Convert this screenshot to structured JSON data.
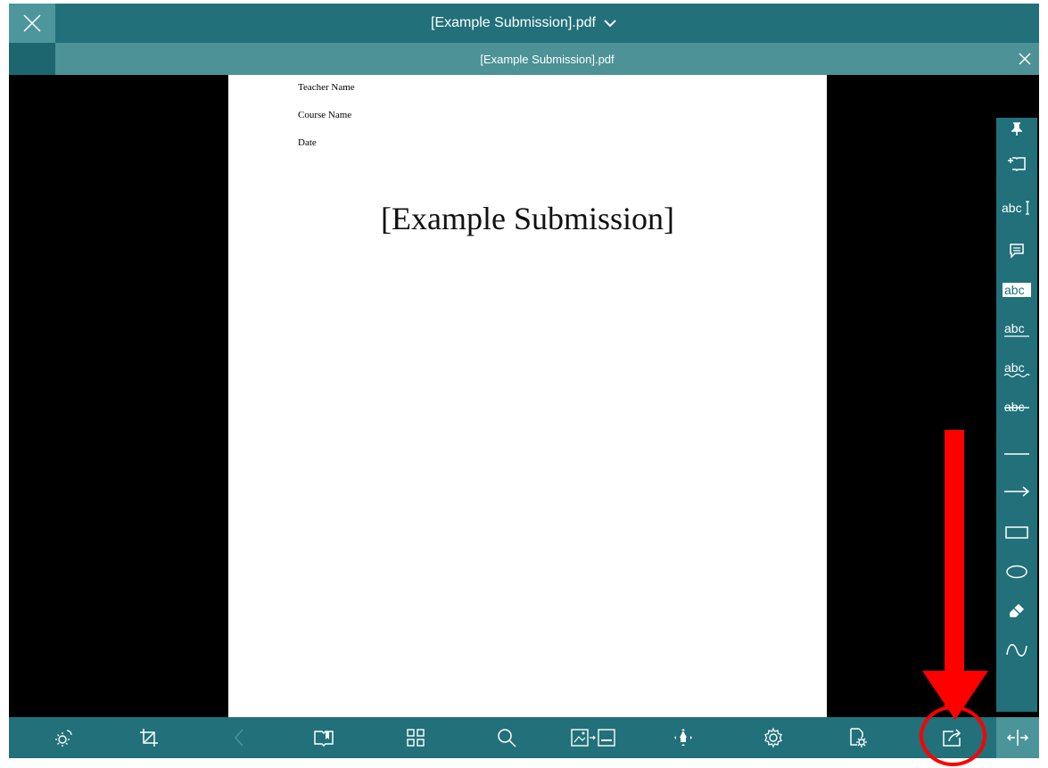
{
  "titlebar": {
    "title": "[Example Submission].pdf"
  },
  "tab": {
    "label": "[Example Submission].pdf"
  },
  "document": {
    "teacher": "Teacher Name",
    "course": "Course Name",
    "date": "Date",
    "title": "[Example Submission]"
  },
  "right_toolbar": {
    "abc": "abc"
  },
  "colors": {
    "toolbar": "#21707a",
    "active": "#4c9297",
    "annotation": "#ff0000"
  }
}
